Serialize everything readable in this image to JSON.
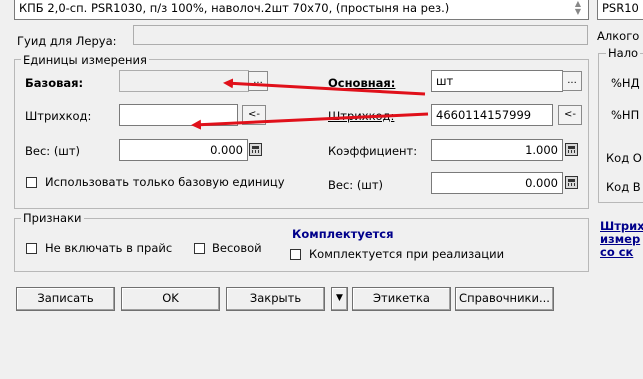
{
  "top": {
    "product_name": "КПБ 2,0-сп. PSR1030, п/з 100%, наволоч.2шт 70х70, (простыня на рез.)",
    "right_code": "PSR10"
  },
  "guid_label": "Гуид для Леруа:",
  "guid_value": "",
  "right_panel": {
    "alco_label": "Алкого",
    "nalog_legend": "Нало",
    "nds_label": "%НД",
    "np_label": "%НП",
    "kod_o_label": "Код О",
    "kod_v_label": "Код В",
    "links": [
      "Штрих",
      "измер",
      "со ск"
    ]
  },
  "units": {
    "legend": "Единицы измерения",
    "base_label": "Базовая:",
    "base_value": "",
    "barcode_label": "Штрихкод:",
    "barcode_value": "",
    "weight_label": "Вес: (шт)",
    "weight_value": "0.000",
    "only_base_label": "Использовать только базовую единицу",
    "main_label": "Основная:",
    "main_value": "шт",
    "barcode2_label": "Штрихкод:",
    "barcode2_value": "4660114157999",
    "coef_label": "Коэффициент:",
    "coef_value": "1.000",
    "weight2_label": "Вес: (шт)",
    "weight2_value": "0.000",
    "dots": "...",
    "arrow_btn": "<-"
  },
  "signs": {
    "legend": "Признаки",
    "no_price_label": "Не включать в прайс",
    "weight_item_label": "Весовой",
    "kit_title": "Комплектуется",
    "kit_label": "Комплектуется при реализации"
  },
  "buttons": {
    "save": "Записать",
    "ok": "OK",
    "close": "Закрыть",
    "dropdown": "▼",
    "label": "Этикетка",
    "refs": "Справочники..."
  },
  "colors": {
    "arrow": "#e0101a",
    "link": "#00008b"
  }
}
